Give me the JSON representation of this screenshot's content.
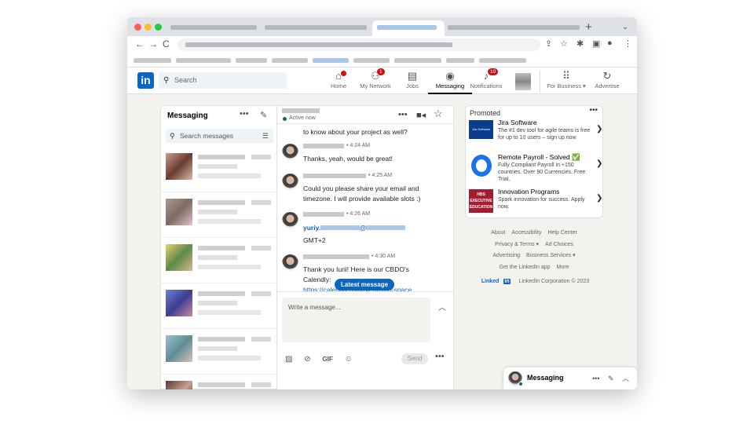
{
  "linkedin": {
    "logo": "in",
    "search_placeholder": "Search",
    "nav": [
      {
        "label": "Home",
        "icon": "home-icon",
        "glyph": "⌂",
        "badge": ""
      },
      {
        "label": "My Network",
        "icon": "network-icon",
        "glyph": "👥",
        "badge": "1"
      },
      {
        "label": "Jobs",
        "icon": "briefcase-icon",
        "glyph": "💼",
        "badge": ""
      },
      {
        "label": "Messaging",
        "icon": "message-icon",
        "glyph": "💬",
        "badge": ""
      },
      {
        "label": "Notifications",
        "icon": "bell-icon",
        "glyph": "🔔",
        "badge": "19"
      }
    ],
    "for_business": "For Business ▾",
    "advertise": "Advertise"
  },
  "messaging": {
    "title": "Messaging",
    "search_placeholder": "Search messages",
    "active_status": "Active now"
  },
  "thread": {
    "messages": [
      {
        "time": "",
        "text": "to know about your project as well?"
      },
      {
        "time": "• 4:24 AM",
        "text": "Thanks, yeah, would be great!"
      },
      {
        "time": "• 4:25 AM",
        "text": "Could you please share your email and timezone. I will provide available slots :)"
      },
      {
        "time": "• 4:26 AM",
        "email_prefix": "yuriy.",
        "email_at": "@",
        "text": "GMT+2"
      },
      {
        "time": "• 4:30 AM",
        "text": "Thank you Iurii! Here is our CBDO's Calendly:",
        "link": "https://calendly.com/alf-promo-space"
      }
    ],
    "latest_pill": "Latest message",
    "composer_placeholder": "Write a message...",
    "gif_label": "GIF",
    "send_label": "Send"
  },
  "promoted": {
    "title": "Promoted",
    "ads": [
      {
        "name": "Jira Software",
        "desc": "The #1 dev tool for agile teams is free for up to 10 users – sign up now",
        "logo_text": "Jira Software"
      },
      {
        "name": "Remote Payroll - Solved ✅",
        "desc": "Fully Compliant Payroll in +150 countries. Over 90 Currencies. Free Trial.",
        "logo_text": ""
      },
      {
        "name": "Innovation Programs",
        "desc": "Spark innovation for success. Apply now.",
        "logo_text": "HBS EXECUTIVE EDUCATION"
      }
    ]
  },
  "footer": {
    "row1": [
      "About",
      "Accessibility",
      "Help Center"
    ],
    "row2": [
      "Privacy & Terms ▾",
      "Ad Choices"
    ],
    "row3": [
      "Advertising",
      "Business Services ▾"
    ],
    "row4": [
      "Get the LinkedIn app",
      "More"
    ],
    "brand": "Linked",
    "brand_in": "in",
    "copyright": "LinkedIn Corporation © 2023"
  },
  "dock": {
    "title": "Messaging"
  },
  "colors": {
    "linkedin_blue": "#0a66c2",
    "online_green": "#057642",
    "badge_red": "#cc1016"
  }
}
